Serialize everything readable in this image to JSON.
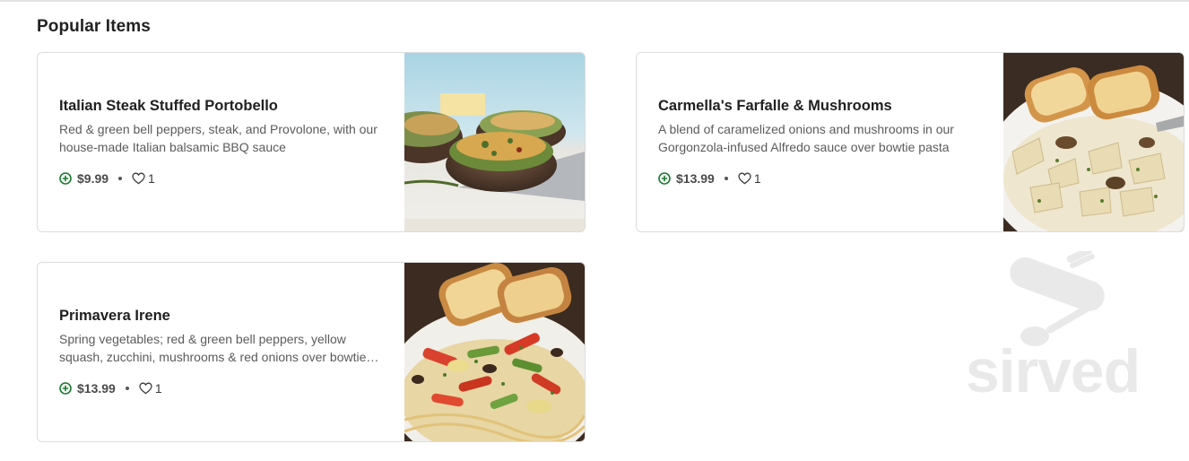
{
  "section": {
    "title": "Popular Items"
  },
  "items": [
    {
      "name": "Italian Steak Stuffed Portobello",
      "description": "Red & green bell peppers, steak, and Provolone, with our house-made Italian balsamic BBQ sauce",
      "price": "$9.99",
      "likes": "1",
      "photo": "stuffed-portobello-photo"
    },
    {
      "name": "Carmella's Farfalle & Mushrooms",
      "description": "A blend of caramelized onions and mushrooms in our Gorgonzola-infused Alfredo sauce over bowtie pasta",
      "price": "$13.99",
      "likes": "1",
      "photo": "farfalle-mushrooms-photo"
    },
    {
      "name": "Primavera Irene",
      "description": "Spring vegetables; red & green bell peppers, yellow squash, zucchini, mushrooms & red onions over bowtie pasta",
      "price": "$13.99",
      "likes": "1",
      "photo": "primavera-irene-photo"
    }
  ],
  "watermark": {
    "text": "sirved"
  },
  "icons": {
    "add": "add-circle-icon",
    "like": "heart-icon"
  },
  "colors": {
    "add_icon": "#1a7a2e",
    "text_primary": "#1f1f1f",
    "text_secondary": "#5b5b5b",
    "card_border": "#dcdcdc"
  }
}
